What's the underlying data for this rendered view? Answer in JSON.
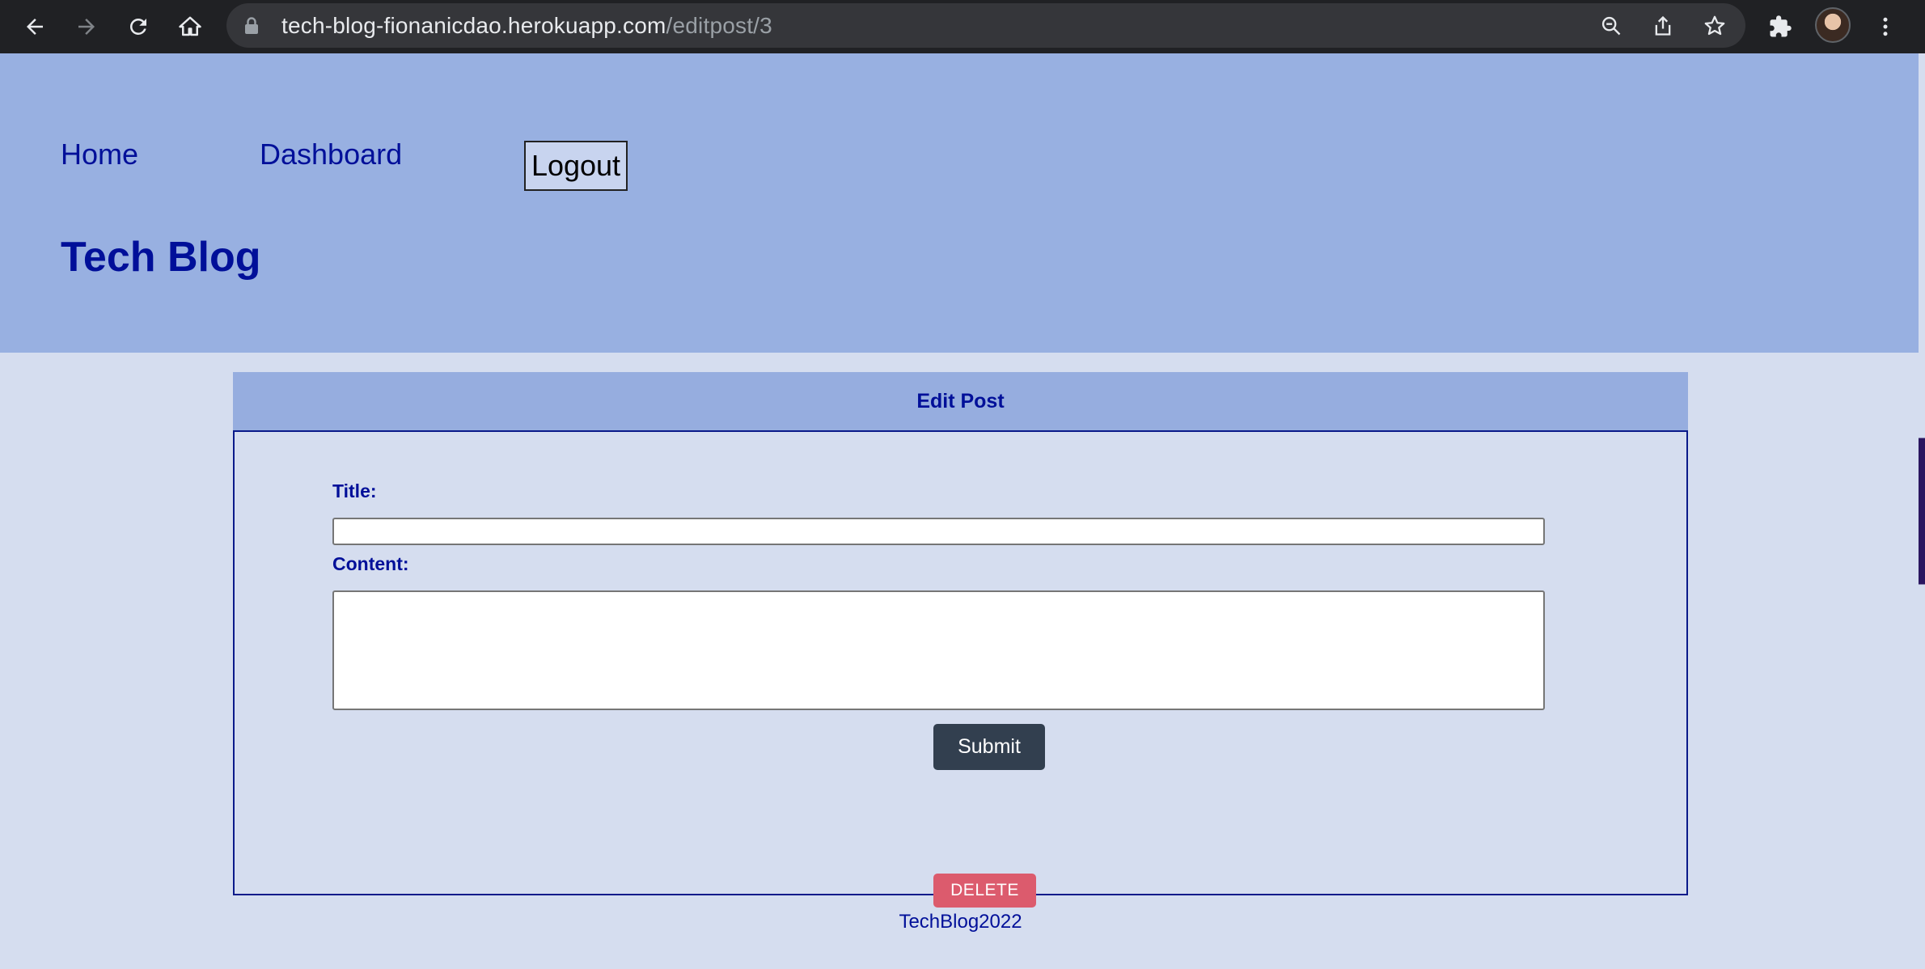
{
  "browser": {
    "url_host": "tech-blog-fionanicdao.herokuapp.com",
    "url_path": "/editpost/3",
    "icons": [
      "back-icon",
      "forward-icon",
      "reload-icon",
      "home-icon",
      "lock-icon",
      "zoom-icon",
      "share-icon",
      "star-icon",
      "extensions-icon",
      "avatar",
      "menu-icon"
    ]
  },
  "nav": {
    "home_label": "Home",
    "dashboard_label": "Dashboard",
    "logout_label": "Logout"
  },
  "site": {
    "title": "Tech Blog"
  },
  "edit_post": {
    "header": "Edit Post",
    "title_label": "Title:",
    "title_value": "",
    "content_label": "Content:",
    "content_value": "",
    "submit_label": "Submit",
    "delete_label": "DELETE"
  },
  "footer": {
    "text": "TechBlog2022"
  },
  "colors": {
    "header_bg": "#98b0e1",
    "page_bg": "#d5ddef",
    "link": "#000f99",
    "submit_bg": "#323f4f",
    "delete_bg": "#dc5b6d"
  }
}
